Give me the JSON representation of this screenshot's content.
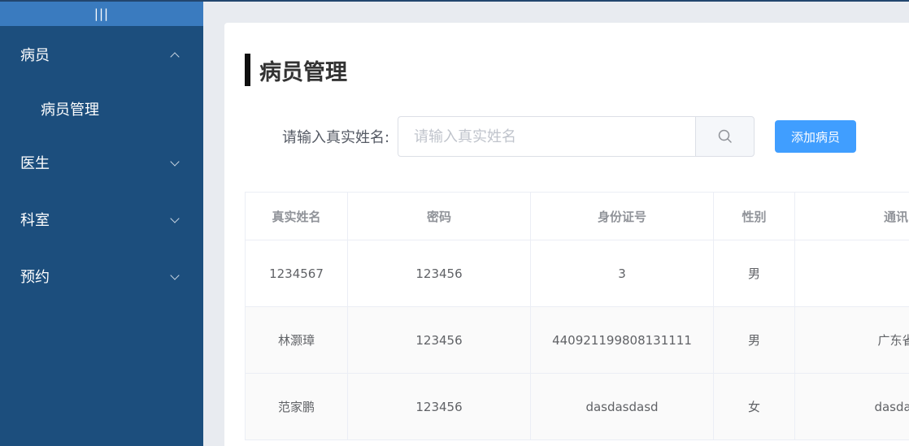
{
  "sidebar": {
    "collapse_label": "|||",
    "menu": [
      {
        "label": "病员",
        "expanded": true,
        "children": [
          {
            "label": "病员管理"
          }
        ]
      },
      {
        "label": "医生",
        "expanded": false
      },
      {
        "label": "科室",
        "expanded": false
      },
      {
        "label": "预约",
        "expanded": false
      }
    ]
  },
  "main": {
    "title": "病员管理",
    "search": {
      "label": "请输入真实姓名:",
      "placeholder": "请输入真实姓名",
      "value": ""
    },
    "add_button": "添加病员",
    "table": {
      "columns": [
        "真实姓名",
        "密码",
        "身份证号",
        "性别",
        "通讯"
      ],
      "rows": [
        [
          "1234567",
          "123456",
          "3",
          "男",
          ""
        ],
        [
          "林灏璋",
          "123456",
          "440921199808131111",
          "男",
          "广东省"
        ],
        [
          "范家鹏",
          "123456",
          "dasdasdasd",
          "女",
          "dasdas"
        ]
      ]
    }
  },
  "colors": {
    "sidebar_bg": "#1c4e7d",
    "collapse_bar": "#3a7bbf",
    "accent": "#409eff",
    "page_bg": "#e8ebf0"
  }
}
